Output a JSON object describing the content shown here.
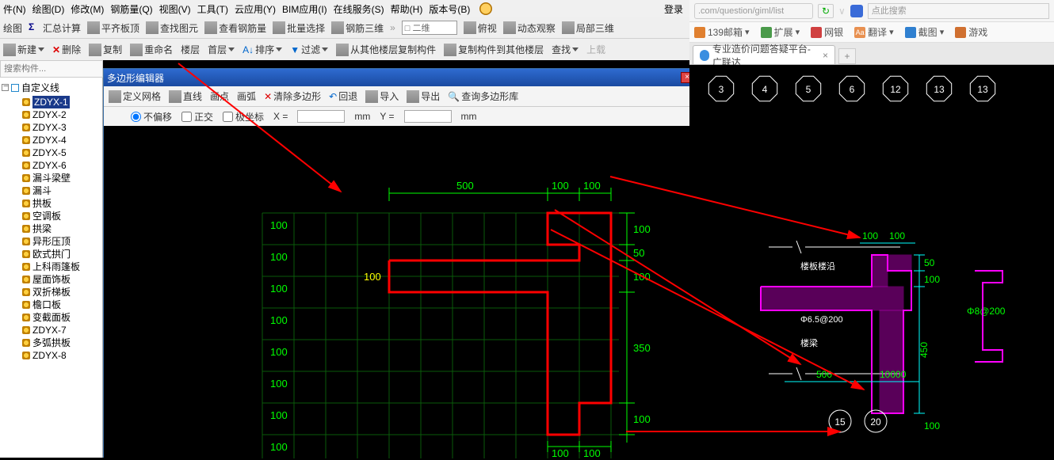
{
  "menu": {
    "items": [
      "件(N)",
      "绘图(D)",
      "修改(M)",
      "钢筋量(Q)",
      "视图(V)",
      "工具(T)",
      "云应用(Y)",
      "BIM应用(I)",
      "在线服务(S)",
      "帮助(H)",
      "版本号(B)"
    ],
    "login": "登录"
  },
  "toolbar1": {
    "items": [
      "绘图",
      "汇总计算",
      "平齐板顶",
      "查找图元",
      "查看钢筋量",
      "批量选择",
      "钢筋三维"
    ],
    "combo": "□ 二维",
    "items2": [
      "俯视",
      "动态观察",
      "局部三维"
    ]
  },
  "toolbar2": {
    "new": "新建",
    "del": "删除",
    "copy": "复制",
    "rename": "重命名",
    "floor": "楼层",
    "first": "首层",
    "sort": "排序",
    "filter": "过滤",
    "copyfrom": "从其他楼层复制构件",
    "copyto": "复制构件到其他楼层",
    "find": "查找",
    "upload": "上载"
  },
  "search": {
    "placeholder": "搜索构件..."
  },
  "tree": {
    "root": "自定义线",
    "items": [
      "ZDYX-1",
      "ZDYX-2",
      "ZDYX-3",
      "ZDYX-4",
      "ZDYX-5",
      "ZDYX-6",
      "漏斗梁壁",
      "漏斗",
      "拱板",
      "空调板",
      "拱梁",
      "异形压顶",
      "欧式拱门",
      "上科雨篷板",
      "屋面饰板",
      "双折梯板",
      "檐口板",
      "变截面板",
      "ZDYX-7",
      "多弧拱板",
      "ZDYX-8"
    ],
    "selected": 0
  },
  "editor": {
    "title": "多边形编辑器",
    "tb1": {
      "grid": "定义网格",
      "line": "直线",
      "pt": "画点",
      "arc": "画弧",
      "clear": "清除多边形",
      "undo": "回退",
      "import": "导入",
      "export": "导出",
      "lib": "查询多边形库"
    },
    "tb2": {
      "noshift": "不偏移",
      "ortho": "正交",
      "polar": "极坐标",
      "xlabel": "X =",
      "xunit": "mm",
      "ylabel": "Y =",
      "yunit": "mm"
    },
    "dims_top": [
      "500",
      "100",
      "100"
    ],
    "dims_right": [
      "100",
      "50",
      "100",
      "350",
      "100"
    ],
    "dims_bottom": [
      "100",
      "100"
    ],
    "dim_left": "100",
    "grid_labels": [
      "100",
      "100",
      "100",
      "100",
      "100",
      "100",
      "100",
      "100"
    ]
  },
  "browser": {
    "url": ".com/question/giml/list",
    "search_ph": "点此搜索",
    "favs": [
      {
        "t": "139邮箱"
      },
      {
        "t": "扩展"
      },
      {
        "t": "网银"
      },
      {
        "t": "翻译"
      },
      {
        "t": "截图"
      },
      {
        "t": "游戏"
      }
    ],
    "tab": "专业造价问题答疑平台-广联达",
    "topnums": [
      "3",
      "4",
      "5",
      "6",
      "12",
      "13",
      "13"
    ],
    "cad": {
      "d500": "500",
      "d100a": "100",
      "d100b": "100",
      "d50": "50",
      "d450": "450",
      "d100c": "100",
      "d10000": "10000",
      "rebar1": "Φ6.5@200",
      "rebar2": "Φ8@200",
      "lbl1": "楼板楼沿",
      "lbl2": "楼梁",
      "circ15": "15",
      "circ20": "20"
    }
  }
}
